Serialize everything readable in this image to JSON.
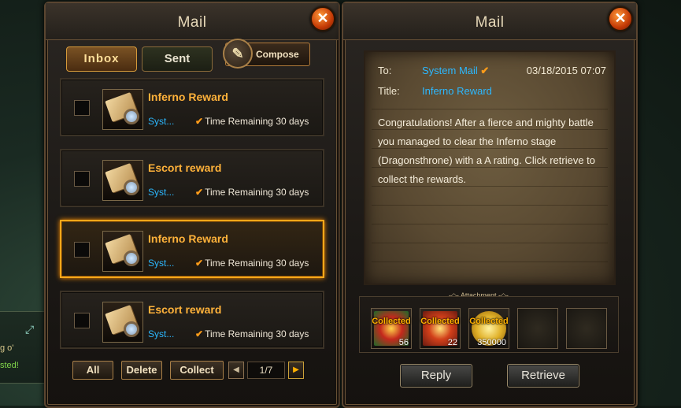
{
  "left_window": {
    "title": "Mail",
    "close": "✕",
    "tabs": [
      {
        "label": "Inbox",
        "active": true
      },
      {
        "label": "Sent",
        "active": false
      }
    ],
    "compose_label": "Compose",
    "mails": [
      {
        "subject": "Inferno Reward",
        "sender": "Syst...",
        "remaining": "Time Remaining 30 days",
        "selected": false
      },
      {
        "subject": "Escort reward",
        "sender": "Syst...",
        "remaining": "Time Remaining 30 days",
        "selected": false
      },
      {
        "subject": "Inferno Reward",
        "sender": "Syst...",
        "remaining": "Time Remaining 30 days",
        "selected": true
      },
      {
        "subject": "Escort reward",
        "sender": "Syst...",
        "remaining": "Time Remaining 30 days",
        "selected": false
      }
    ],
    "buttons": {
      "all": "All",
      "delete": "Delete",
      "collect": "Collect"
    },
    "pager": "1/7"
  },
  "right_window": {
    "title": "Mail",
    "close": "✕",
    "to_label": "To:",
    "to_value": "System Mail",
    "date": "03/18/2015 07:07",
    "title_label": "Title:",
    "title_value": "Inferno Reward",
    "body": "Congratulations! After a fierce and mighty battle you managed to clear the Inferno stage (Dragonsthrone) with a A rating. Click retrieve to collect the rewards.",
    "attachment_label": "Attachment",
    "attachments": [
      {
        "status": "Collected",
        "qty": "56",
        "color": "#b8201a"
      },
      {
        "status": "Collected",
        "qty": "22",
        "color": "#c83a10"
      },
      {
        "status": "Collected",
        "qty": "350000",
        "color": "#c8a020"
      },
      {
        "status": "",
        "qty": ""
      },
      {
        "status": "",
        "qty": ""
      }
    ],
    "reply_label": "Reply",
    "retrieve_label": "Retrieve"
  },
  "background": {
    "chat_line_1": "g o'",
    "chat_line_2": "sted!"
  },
  "colors": {
    "accent_orange": "#ffa81a",
    "sender_blue": "#2cb8ff",
    "subject_gold": "#ffb23a"
  }
}
